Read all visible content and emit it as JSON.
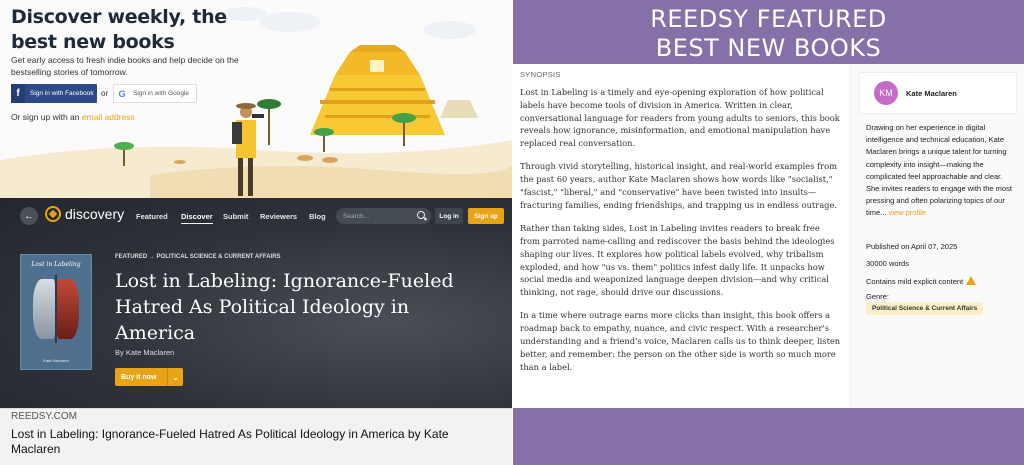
{
  "hero": {
    "title_line1": "Discover weekly, the",
    "title_line2": "best new books",
    "subtitle": "Get early access to fresh indie books and help decide on the bestselling stories of tomorrow.",
    "facebook_button": "Sign in with Facebook",
    "or_text": "or",
    "google_button": "Sign in with Google",
    "email_prefix": "Or sign up with an",
    "email_link": "email address"
  },
  "discovery": {
    "logo": "discovery",
    "nav": [
      "Featured",
      "Discover",
      "Submit",
      "Reviewers",
      "Blog"
    ],
    "active_nav": "Discover",
    "search_placeholder": "Search...",
    "login": "Log in",
    "signup": "Sign up",
    "breadcrumb": "FEATURED → POLITICAL SCIENCE & CURRENT AFFAIRS",
    "book_title": "Lost in Labeling: Ignorance-Fueled Hatred As Political Ideology in America",
    "byline": "By Kate Maclaren",
    "buy_button": "Buy it now",
    "cover_title": "Lost in Labeling",
    "cover_author": "Kate Maclaren"
  },
  "link_preview": {
    "domain": "REEDSY.COM",
    "title": "Lost in Labeling: Ignorance-Fueled Hatred As Political Ideology in America by Kate Maclaren"
  },
  "banner": {
    "line1": "REEDSY FEATURED",
    "line2": "BEST NEW BOOKS"
  },
  "synopsis": {
    "label": "SYNOPSIS",
    "paragraphs": [
      "Lost in Labeling is a timely and eye-opening exploration of how political labels have become tools of division in America. Written in clear, conversational language for readers from young adults to seniors, this book reveals how ignorance, misinformation, and emotional manipulation have replaced real conversation.",
      "Through vivid storytelling, historical insight, and real-world examples from the past 60 years, author Kate Maclaren shows how words like \"socialist,\" \"fascist,\" \"liberal,\" and \"conservative\" have been twisted into insults—fracturing families, ending friendships, and trapping us in endless outrage.",
      "Rather than taking sides, Lost in Labeling invites readers to break free from parroted name-calling and rediscover the basis behind the ideologies shaping our lives. It explores how political labels evolved, why tribalism exploded, and how \"us vs. them\" politics infest daily life. It unpacks how social media and weaponized language deepen division—and why critical thinking, not rage, should drive our discussions.",
      "In a time where outrage earns more clicks than insight, this book offers a roadmap back to empathy, nuance, and civic respect. With a researcher's understanding and a friend's voice, Maclaren calls us to think deeper, listen better, and remember: the person on the other side is worth so much more than a label."
    ]
  },
  "author": {
    "initials": "KM",
    "name": "Kate Maclaren",
    "bio": "Drawing on her experience in digital intelligence and technical education, Kate Maclaren brings a unique talent for turning complexity into insight—making the complicated feel approachable and clear. She invites readers to engage with the most pressing and often polarizing topics of our time...",
    "view_profile": "view profile",
    "published": "Published on April 07, 2025",
    "words": "30000 words",
    "content_warning": "Contains mild explicit content",
    "genre_label": "Genre:",
    "genre": "Political Science & Current Affairs"
  },
  "colors": {
    "accent": "#e8a317",
    "purple": "#8571a8",
    "dark": "#2b3138"
  }
}
